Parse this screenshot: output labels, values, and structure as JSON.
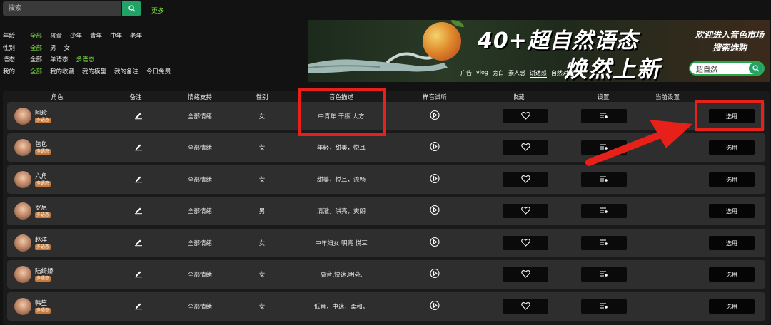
{
  "search": {
    "placeholder": "搜索",
    "more_label": "更多"
  },
  "filters": [
    {
      "label": "年龄:",
      "options": [
        "全部",
        "孩童",
        "少年",
        "青年",
        "中年",
        "老年"
      ],
      "active": 0
    },
    {
      "label": "性别:",
      "options": [
        "全部",
        "男",
        "女"
      ],
      "active": 0
    },
    {
      "label": "语态:",
      "options": [
        "全部",
        "单语态",
        "多语态"
      ],
      "active": 2
    },
    {
      "label": "我的:",
      "options": [
        "全部",
        "我的收藏",
        "我的模型",
        "我的备注",
        "今日免费"
      ],
      "active": 0
    }
  ],
  "banner": {
    "title1": "40+超自然语态",
    "title2": "焕然上新",
    "tags": [
      "广告",
      "vlog",
      "旁白",
      "素人感",
      "讲述感",
      "自然对话"
    ],
    "active_tag": 4,
    "market_line1": "欢迎进入音色市场",
    "market_line2": "搜索选购",
    "search_value": "超自然"
  },
  "table": {
    "headers": {
      "role": "角色",
      "note": "备注",
      "emotion": "情绪支持",
      "gender": "性别",
      "desc": "音色描述",
      "sample": "样音试听",
      "favorite": "收藏",
      "settings": "设置",
      "current": "当前设置"
    },
    "rows": [
      {
        "name": "阿珍",
        "badge": "多语态",
        "emotion": "全部情绪",
        "gender": "女",
        "desc": "中青年 干练 大方",
        "action": "选用"
      },
      {
        "name": "包包",
        "badge": "多语态",
        "emotion": "全部情绪",
        "gender": "女",
        "desc": "年轻，甜美，悦耳",
        "action": "选用"
      },
      {
        "name": "六角",
        "badge": "多语态",
        "emotion": "全部情绪",
        "gender": "女",
        "desc": "甜美，悦耳，流畅",
        "action": "选用"
      },
      {
        "name": "罗尼",
        "badge": "多语态",
        "emotion": "全部情绪",
        "gender": "男",
        "desc": "清澈，洪亮，爽朗",
        "action": "选用"
      },
      {
        "name": "赵洋",
        "badge": "多语态",
        "emotion": "全部情绪",
        "gender": "女",
        "desc": "中年妇女 明亮 悦耳",
        "action": "选用"
      },
      {
        "name": "陆绮娇",
        "badge": "多语态",
        "emotion": "全部情绪",
        "gender": "女",
        "desc": "高音,快速,明亮,",
        "action": "选用"
      },
      {
        "name": "韩笙",
        "badge": "多语态",
        "emotion": "全部情绪",
        "gender": "女",
        "desc": "低音，中速，柔和，",
        "action": "选用"
      }
    ]
  },
  "colors": {
    "accent_green": "#7be03c",
    "button_green": "#21a366",
    "annotation_red": "#e8201a",
    "badge_orange": "#c87a3a"
  }
}
